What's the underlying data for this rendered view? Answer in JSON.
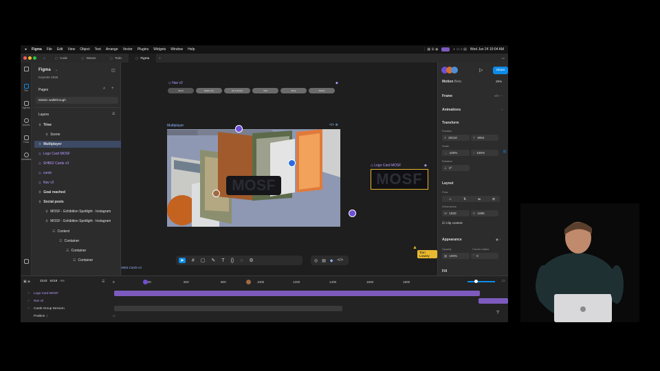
{
  "menubar": {
    "app": "Figma",
    "items": [
      "File",
      "Edit",
      "View",
      "Object",
      "Text",
      "Arrange",
      "Vector",
      "Plugins",
      "Widgets",
      "Window",
      "Help"
    ],
    "clock": "Wed Jun 24  10:04 AM"
  },
  "tabs": [
    {
      "label": "Code"
    },
    {
      "label": "Weave"
    },
    {
      "label": "Todo"
    },
    {
      "label": "Figma"
    }
  ],
  "left_panel": {
    "title": "Figma",
    "subtitle": "Keynote 2026",
    "pages_label": "Pages",
    "current_page": "Motion walkthrough",
    "layers_label": "Layers",
    "layers": [
      "Triee",
      "Scene",
      "Multiplayer",
      "Logo Card MOSF",
      "SHB62 Cards v3",
      "cards",
      "Nav v2",
      "Goal reached",
      "Social posts",
      "MOSF - Exhibition Spotlight - Instagram",
      "MOSF - Exhibition Spotlight - Instagram",
      "Content",
      "Container",
      "Container",
      "Container"
    ],
    "rail": [
      "File",
      "Agents",
      "Assets",
      "Tools",
      "Variables"
    ]
  },
  "canvas": {
    "nav_label": "Nav v2",
    "nav_pills": [
      "All Art",
      "What's On",
      "Art & Artists",
      "Visit",
      "Shop",
      "Tickets"
    ],
    "multiplayer_label": "Multiplayer",
    "logo_card_label": "Logo Card MOSF",
    "logo_text": "MOSF",
    "cursor_name": "Tom Lowery",
    "cards_label": "4983 Cards v3"
  },
  "right_panel": {
    "share": "Share",
    "zoom": "29%",
    "mode": "Motion",
    "mode_badge": "Beta",
    "frame": "Frame",
    "animations": "Animations",
    "transform": "Transform",
    "position_label": "Position",
    "x": "20210",
    "y": "4954",
    "scale_label": "Scale",
    "scale_x": "100%",
    "scale_y": "100%",
    "rotation_label": "Rotation",
    "rotation": "0°",
    "layout": "Layout",
    "flow_label": "Flow",
    "dimensions_label": "Dimensions",
    "w": "1920",
    "h": "1080",
    "clip": "Clip content",
    "appearance": "Appearance",
    "opacity_label": "Opacity",
    "corner_label": "Corner radius",
    "opacity": "100%",
    "corner": "0",
    "fill": "Fill"
  },
  "timeline": {
    "frame": "2242",
    "frame2": "5219",
    "unit": "ms",
    "ticks": [
      "0",
      "400",
      "600",
      "800",
      "1000",
      "1200",
      "1400",
      "1600",
      "1800"
    ],
    "tracks": [
      "Logo Card MOSF",
      "Nav v2",
      "Cards Group Dezoom",
      "Position"
    ]
  },
  "colors": {
    "accent": "#0c8ce9",
    "purple": "#7d5bbe",
    "logo_border": "#e8b830"
  }
}
